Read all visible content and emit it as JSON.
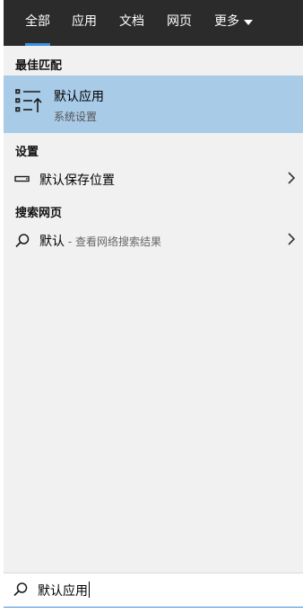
{
  "tabs": [
    {
      "label": "全部",
      "active": true
    },
    {
      "label": "应用",
      "active": false
    },
    {
      "label": "文档",
      "active": false
    },
    {
      "label": "网页",
      "active": false
    },
    {
      "label": "更多",
      "active": false,
      "dropdown": true
    }
  ],
  "best_match": {
    "heading": "最佳匹配",
    "title": "默认应用",
    "subtitle": "系统设置",
    "icon": "default-apps-icon"
  },
  "settings": {
    "heading": "设置",
    "items": [
      {
        "label": "默认保存位置",
        "icon": "storage-icon"
      }
    ]
  },
  "web_search": {
    "heading": "搜索网页",
    "items": [
      {
        "query": "默认",
        "hint": " - 查看网络搜索结果",
        "icon": "search-icon"
      }
    ]
  },
  "search": {
    "value": "默认应用",
    "icon": "search-icon"
  },
  "colors": {
    "tabbar_bg": "#2b2b2b",
    "accent": "#3d8fe0",
    "selected_bg": "#a8cbe8",
    "panel_bg": "#f1f1f1"
  }
}
